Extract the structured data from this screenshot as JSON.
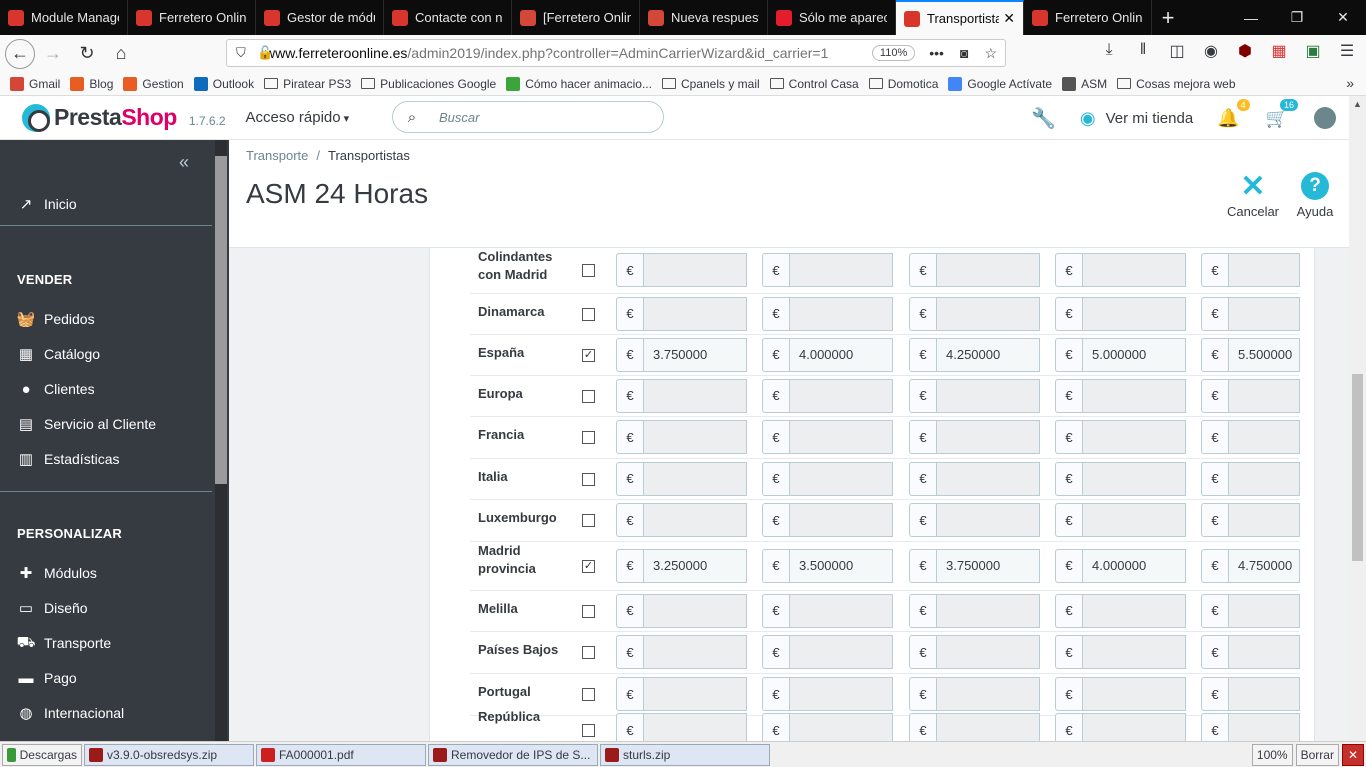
{
  "browser": {
    "tabs": [
      {
        "label": "Module Manage",
        "color": "#d9362b",
        "active": false
      },
      {
        "label": "Ferretero Online",
        "color": "#d9362b",
        "active": false
      },
      {
        "label": "Gestor de módu",
        "color": "#d9362b",
        "active": false
      },
      {
        "label": "Contacte con no",
        "color": "#d9362b",
        "active": false
      },
      {
        "label": "[Ferretero Onlin",
        "color": "#d44638",
        "active": false
      },
      {
        "label": "Nueva respuesta",
        "color": "#d44638",
        "active": false
      },
      {
        "label": "Sólo me aparece",
        "color": "#e31d2b",
        "active": false
      },
      {
        "label": "Transportista",
        "color": "#d9362b",
        "active": true
      },
      {
        "label": "Ferretero Online",
        "color": "#d9362b",
        "active": false
      }
    ],
    "new_tab": "+",
    "url_domain": "www.ferreteroonline.es",
    "url_rest": "/admin2019/index.php?controller=AdminCarrierWizard&id_carrier=1",
    "zoom": "110%",
    "bookmarks": [
      {
        "label": "Gmail",
        "type": "icon",
        "color": "#d44638"
      },
      {
        "label": "Blog",
        "type": "icon",
        "color": "#e85d24"
      },
      {
        "label": "Gestion",
        "type": "icon",
        "color": "#e85d24"
      },
      {
        "label": "Outlook",
        "type": "icon",
        "color": "#0f6cbd"
      },
      {
        "label": "Piratear PS3",
        "type": "folder"
      },
      {
        "label": "Publicaciones Google",
        "type": "folder"
      },
      {
        "label": "Cómo hacer animacio...",
        "type": "icon",
        "color": "#3aa53a"
      },
      {
        "label": "Cpanels y mail",
        "type": "folder"
      },
      {
        "label": "Control Casa",
        "type": "folder"
      },
      {
        "label": "Domotica",
        "type": "folder"
      },
      {
        "label": "Google Actívate",
        "type": "icon",
        "color": "#4285f4"
      },
      {
        "label": "ASM",
        "type": "icon",
        "color": "#555555"
      },
      {
        "label": "Cosas mejora web",
        "type": "folder"
      }
    ]
  },
  "header": {
    "brand_a": "Presta",
    "brand_b": "Shop",
    "version": "1.7.6.2",
    "quick_access": "Acceso rápido",
    "search_placeholder": "Buscar",
    "view_shop": "Ver mi tienda",
    "notif_orders": "4",
    "notif_customers": "16",
    "colors": {
      "brand_pink": "#df0067",
      "accent": "#25b9d7",
      "orange_badge": "#fbbb22"
    }
  },
  "sidebar": {
    "home": "Inicio",
    "section_sell": "VENDER",
    "sell_items": [
      "Pedidos",
      "Catálogo",
      "Clientes",
      "Servicio al Cliente",
      "Estadísticas"
    ],
    "section_customize": "PERSONALIZAR",
    "customize_items": [
      "Módulos",
      "Diseño",
      "Transporte",
      "Pago",
      "Internacional"
    ]
  },
  "page": {
    "breadcrumb": [
      "Transporte",
      "Transportistas"
    ],
    "title": "ASM 24 Horas",
    "cancel": "Cancelar",
    "help": "Ayuda"
  },
  "table": {
    "currency": "€",
    "rows": [
      {
        "zone": "Colindantes con Madrid",
        "checked": false,
        "values": [
          "",
          "",
          "",
          "",
          ""
        ]
      },
      {
        "zone": "Dinamarca",
        "checked": false,
        "values": [
          "",
          "",
          "",
          "",
          ""
        ]
      },
      {
        "zone": "España",
        "checked": true,
        "values": [
          "3.750000",
          "4.000000",
          "4.250000",
          "5.000000",
          "5.500000"
        ]
      },
      {
        "zone": "Europa",
        "checked": false,
        "values": [
          "",
          "",
          "",
          "",
          ""
        ]
      },
      {
        "zone": "Francia",
        "checked": false,
        "values": [
          "",
          "",
          "",
          "",
          ""
        ]
      },
      {
        "zone": "Italia",
        "checked": false,
        "values": [
          "",
          "",
          "",
          "",
          ""
        ]
      },
      {
        "zone": "Luxemburgo",
        "checked": false,
        "values": [
          "",
          "",
          "",
          "",
          ""
        ]
      },
      {
        "zone": "Madrid provincia",
        "checked": true,
        "values": [
          "3.250000",
          "3.500000",
          "3.750000",
          "4.000000",
          "4.750000"
        ]
      },
      {
        "zone": "Melilla",
        "checked": false,
        "values": [
          "",
          "",
          "",
          "",
          ""
        ]
      },
      {
        "zone": "Países Bajos",
        "checked": false,
        "values": [
          "",
          "",
          "",
          "",
          ""
        ]
      },
      {
        "zone": "Portugal",
        "checked": false,
        "values": [
          "",
          "",
          "",
          "",
          ""
        ]
      },
      {
        "zone": "República",
        "checked": false,
        "values": [
          "",
          "",
          "",
          "",
          ""
        ]
      }
    ]
  },
  "downloads": {
    "label": "Descargas",
    "items": [
      "v3.9.0-obsredsys.zip",
      "FA000001.pdf",
      "Removedor de IPS de S...",
      "sturls.zip"
    ],
    "zoom": "100%",
    "clear": "Borrar",
    "close": "✕"
  }
}
